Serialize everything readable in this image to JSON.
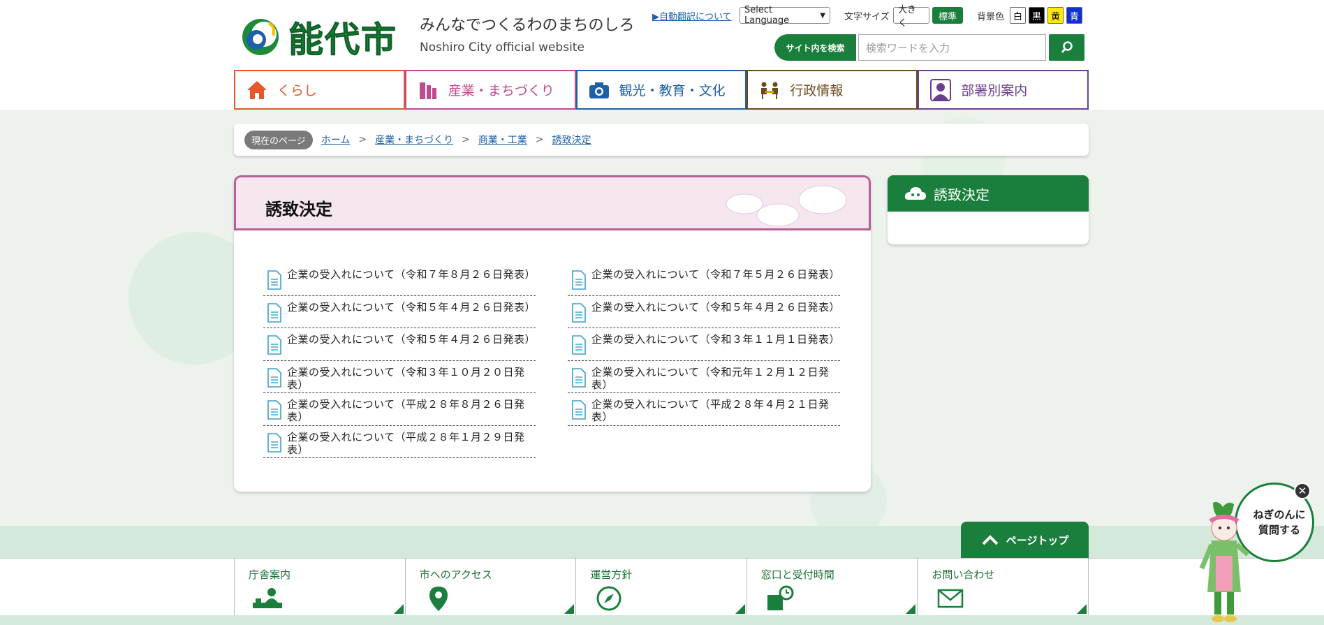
{
  "header": {
    "logo_text": "能代市",
    "tagline_jp": "みんなでつくるわのまちのしろ",
    "tagline_en": "Noshiro City official website",
    "auto_translate": "▶自動翻訳について",
    "language_select": "Select Language",
    "font_size_label": "文字サイズ",
    "font_size_large": "大きく",
    "font_size_normal": "標準",
    "bg_color_label": "背景色",
    "bg_white": "白",
    "bg_black": "黒",
    "bg_yellow": "黄",
    "bg_blue": "青",
    "search_label": "サイト内を検索",
    "search_placeholder": "検索ワードを入力"
  },
  "global_nav": [
    {
      "label": "くらし",
      "color": "#e8572a"
    },
    {
      "label": "産業・まちづくり",
      "color": "#c14a8f"
    },
    {
      "label": "観光・教育・文化",
      "color": "#1d5fa8"
    },
    {
      "label": "行政情報",
      "color": "#6b4a1f"
    },
    {
      "label": "部署別案内",
      "color": "#6a3f91"
    }
  ],
  "breadcrumb": {
    "current_label": "現在のページ",
    "items": [
      "ホーム",
      "産業・まちづくり",
      "商業・工業",
      "誘致決定"
    ],
    "separator": ">"
  },
  "page": {
    "title": "誘致決定",
    "left_items": [
      "企業の受入れについて（令和７年８月２６日発表）",
      "企業の受入れについて（令和５年４月２６日発表）",
      "企業の受入れについて（令和５年４月２６日発表）",
      "企業の受入れについて（令和３年１０月２０日発表）",
      "企業の受入れについて（平成２８年８月２６日発表）",
      "企業の受入れについて（平成２８年１月２９日発表）"
    ],
    "right_items": [
      "企業の受入れについて（令和７年５月２６日発表）",
      "企業の受入れについて（令和５年４月２６日発表）",
      "企業の受入れについて（令和３年１１月１日発表）",
      "企業の受入れについて（令和元年１２月１２日発表）",
      "企業の受入れについて（平成２８年４月２１日発表）"
    ]
  },
  "side_menu": {
    "title": "誘致決定"
  },
  "page_top": "ページトップ",
  "footer_nav": [
    {
      "label": "庁舎案内",
      "icon": "reception-icon"
    },
    {
      "label": "市へのアクセス",
      "icon": "map-pin-icon"
    },
    {
      "label": "運営方針",
      "icon": "compass-icon"
    },
    {
      "label": "窓口と受付時間",
      "icon": "clock-icon"
    },
    {
      "label": "お問い合わせ",
      "icon": "mail-icon"
    }
  ],
  "chatbot": {
    "line1": "ねぎのんに",
    "line2": "質問する",
    "close": "✕"
  },
  "colors": {
    "brand_green": "#1a7f3c",
    "accent_pink": "#b65f97",
    "link_blue": "#1d5fa8"
  }
}
